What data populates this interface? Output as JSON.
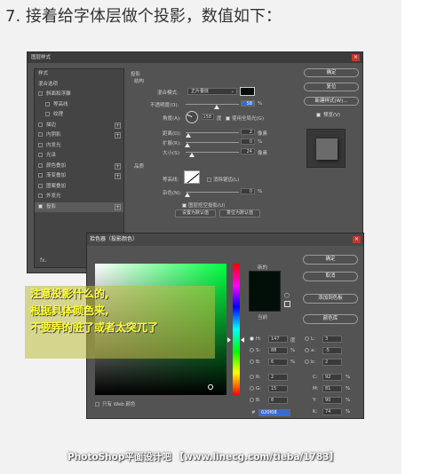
{
  "step_title": "7. 接着给字体层做个投影，数值如下：",
  "layer_style": {
    "title": "图层样式",
    "close": "×",
    "sidebar": [
      {
        "label": "样式",
        "checkbox": false,
        "plus": false,
        "indent": false
      },
      {
        "label": "混合选项",
        "checkbox": false,
        "plus": false,
        "indent": false
      },
      {
        "label": "斜面和浮雕",
        "checkbox": true,
        "plus": false,
        "indent": false
      },
      {
        "label": "等高线",
        "checkbox": true,
        "plus": false,
        "indent": true
      },
      {
        "label": "纹理",
        "checkbox": true,
        "plus": false,
        "indent": true
      },
      {
        "label": "描边",
        "checkbox": true,
        "plus": true,
        "indent": false
      },
      {
        "label": "内阴影",
        "checkbox": true,
        "plus": true,
        "indent": false
      },
      {
        "label": "内发光",
        "checkbox": true,
        "plus": false,
        "indent": false
      },
      {
        "label": "光泽",
        "checkbox": true,
        "plus": false,
        "indent": false
      },
      {
        "label": "颜色叠加",
        "checkbox": true,
        "plus": true,
        "indent": false
      },
      {
        "label": "渐变叠加",
        "checkbox": true,
        "plus": true,
        "indent": false
      },
      {
        "label": "图案叠加",
        "checkbox": true,
        "plus": false,
        "indent": false
      },
      {
        "label": "外发光",
        "checkbox": true,
        "plus": false,
        "indent": false
      },
      {
        "label": "投影",
        "checkbox": true,
        "plus": true,
        "indent": false,
        "active": true
      }
    ],
    "fx_label": "fx.",
    "shadow_group": "投影",
    "structure_group": "结构",
    "blend_mode_label": "混合模式:",
    "blend_mode_value": "正片叠底",
    "opacity_label": "不透明度(O):",
    "opacity_value": "58",
    "angle_label": "角度(A):",
    "angle_value": "158",
    "angle_unit": "度",
    "global_light_label": "使用全局光(G)",
    "distance_label": "距离(D):",
    "distance_value": "2",
    "spread_label": "扩展(R):",
    "spread_value": "0",
    "size_label": "大小(S):",
    "size_value": "24",
    "unit_px": "像素",
    "unit_pct": "%",
    "quality_group": "品质",
    "contour_label": "等高线:",
    "antialias_label": "消除锯齿(L)",
    "noise_label": "杂色(N):",
    "noise_value": "0",
    "knockout_label": "图层挖空投影(U)",
    "make_default": "设置为默认值",
    "reset_default": "复位为默认值",
    "buttons": [
      "确定",
      "复位",
      "新建样式(W)...",
      "预览(V)"
    ],
    "shadow_color": "#020f08"
  },
  "color_picker": {
    "title": "拾色器（投影颜色）",
    "close": "×",
    "new_label": "新的",
    "current_label": "当前",
    "buttons": {
      "ok": "确定",
      "cancel": "取消",
      "add": "添加到色板",
      "library": "颜色库"
    },
    "web_only_label": "只有 Web 颜色",
    "fields": {
      "H": {
        "value": "147",
        "unit": "度"
      },
      "S": {
        "value": "88",
        "unit": "%"
      },
      "B": {
        "value": "6",
        "unit": "%"
      },
      "R": {
        "value": "2",
        "unit": ""
      },
      "G": {
        "value": "15",
        "unit": ""
      },
      "Bb": {
        "value": "8",
        "unit": ""
      },
      "L": {
        "value": "3",
        "unit": ""
      },
      "a": {
        "value": "-5",
        "unit": ""
      },
      "b": {
        "value": "2",
        "unit": ""
      },
      "C": {
        "value": "92",
        "unit": "%"
      },
      "M": {
        "value": "81",
        "unit": "%"
      },
      "Y": {
        "value": "90",
        "unit": "%"
      },
      "K": {
        "value": "74",
        "unit": "%"
      }
    },
    "hex_prefix": "#",
    "hex_value": "020f08"
  },
  "note": {
    "lines": [
      "注意投影什么的,",
      "根据具体颜色来,",
      "不要弄的脏了或者太突兀了"
    ]
  },
  "watermark": "PhotoShop平面设计吧 【www.linecg.com/tieba/1783】"
}
